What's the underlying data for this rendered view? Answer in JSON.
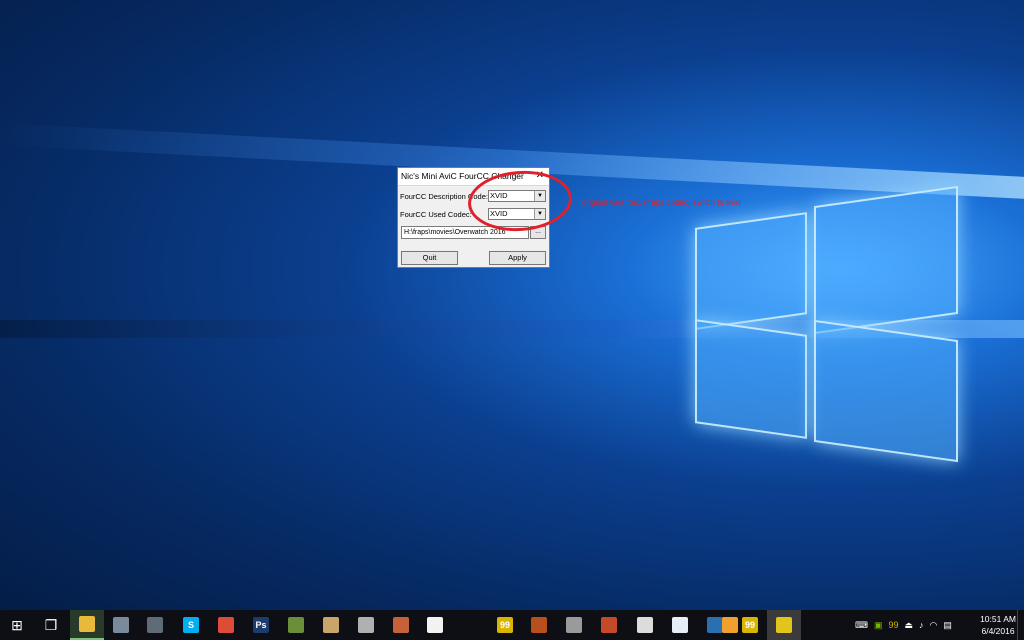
{
  "dialog": {
    "title": "Nic's Mini AviC FourCC Changer",
    "close_glyph": "✕",
    "description_label": "FourCC Description Code:",
    "description_value": "XVID",
    "used_codec_label": "FourCC Used Codec:",
    "used_codec_value": "XVID",
    "path_value": "H:\\fraps\\movies\\Overwatch 2016",
    "browse_label": "...",
    "quit_label": "Quit",
    "apply_label": "Apply"
  },
  "annotation": {
    "text": "original was fps1 (fraps codec) switch to xvid",
    "color": "#e0202a"
  },
  "taskbar": {
    "items": [
      {
        "name": "start-button",
        "glyph": "⊞",
        "color": "#0e0f14"
      },
      {
        "name": "task-view-button",
        "glyph": "❐",
        "color": "#0e0f14"
      },
      {
        "name": "file-explorer",
        "glyph": "",
        "color": "#e8b93a"
      },
      {
        "name": "app-printer",
        "glyph": "",
        "color": "#7b8a9a"
      },
      {
        "name": "app-film",
        "glyph": "",
        "color": "#5f6b76"
      },
      {
        "name": "skype",
        "glyph": "S",
        "color": "#00aff0"
      },
      {
        "name": "chrome",
        "glyph": "",
        "color": "#dd4b39"
      },
      {
        "name": "photoshop",
        "glyph": "Ps",
        "color": "#1c3b6e"
      },
      {
        "name": "app-minecraft",
        "glyph": "",
        "color": "#6b8e3a"
      },
      {
        "name": "app-paint",
        "glyph": "",
        "color": "#c9a46b"
      },
      {
        "name": "app-media",
        "glyph": "",
        "color": "#b0b0b0"
      },
      {
        "name": "app-archive",
        "glyph": "",
        "color": "#c5623a"
      },
      {
        "name": "app-document",
        "glyph": "",
        "color": "#f2f2f2"
      },
      {
        "name": "fraps",
        "glyph": "99",
        "color": "#d9b400"
      },
      {
        "name": "app-emblem",
        "glyph": "",
        "color": "#b8501e"
      },
      {
        "name": "app-sword",
        "glyph": "",
        "color": "#9a9a9a"
      },
      {
        "name": "app-tools",
        "glyph": "",
        "color": "#c44a2a"
      },
      {
        "name": "app-monitor",
        "glyph": "",
        "color": "#dcdcdc"
      },
      {
        "name": "app-cloud",
        "glyph": "",
        "color": "#e8eef5"
      },
      {
        "name": "app-network",
        "glyph": "",
        "color": "#2b6fb0"
      },
      {
        "name": "overwatch",
        "glyph": "",
        "color": "#f0a030"
      },
      {
        "name": "fraps-2",
        "glyph": "99",
        "color": "#d9b400"
      },
      {
        "name": "nic-fourcc-changer",
        "glyph": "",
        "color": "#e3c41a"
      }
    ],
    "tray_icons": [
      "keyboard-icon",
      "nvidia-icon",
      "fraps-tray-icon",
      "usb-icon",
      "speaker-icon",
      "wifi-icon",
      "message-icon"
    ],
    "time": "10:51 AM",
    "date": "6/4/2016"
  }
}
